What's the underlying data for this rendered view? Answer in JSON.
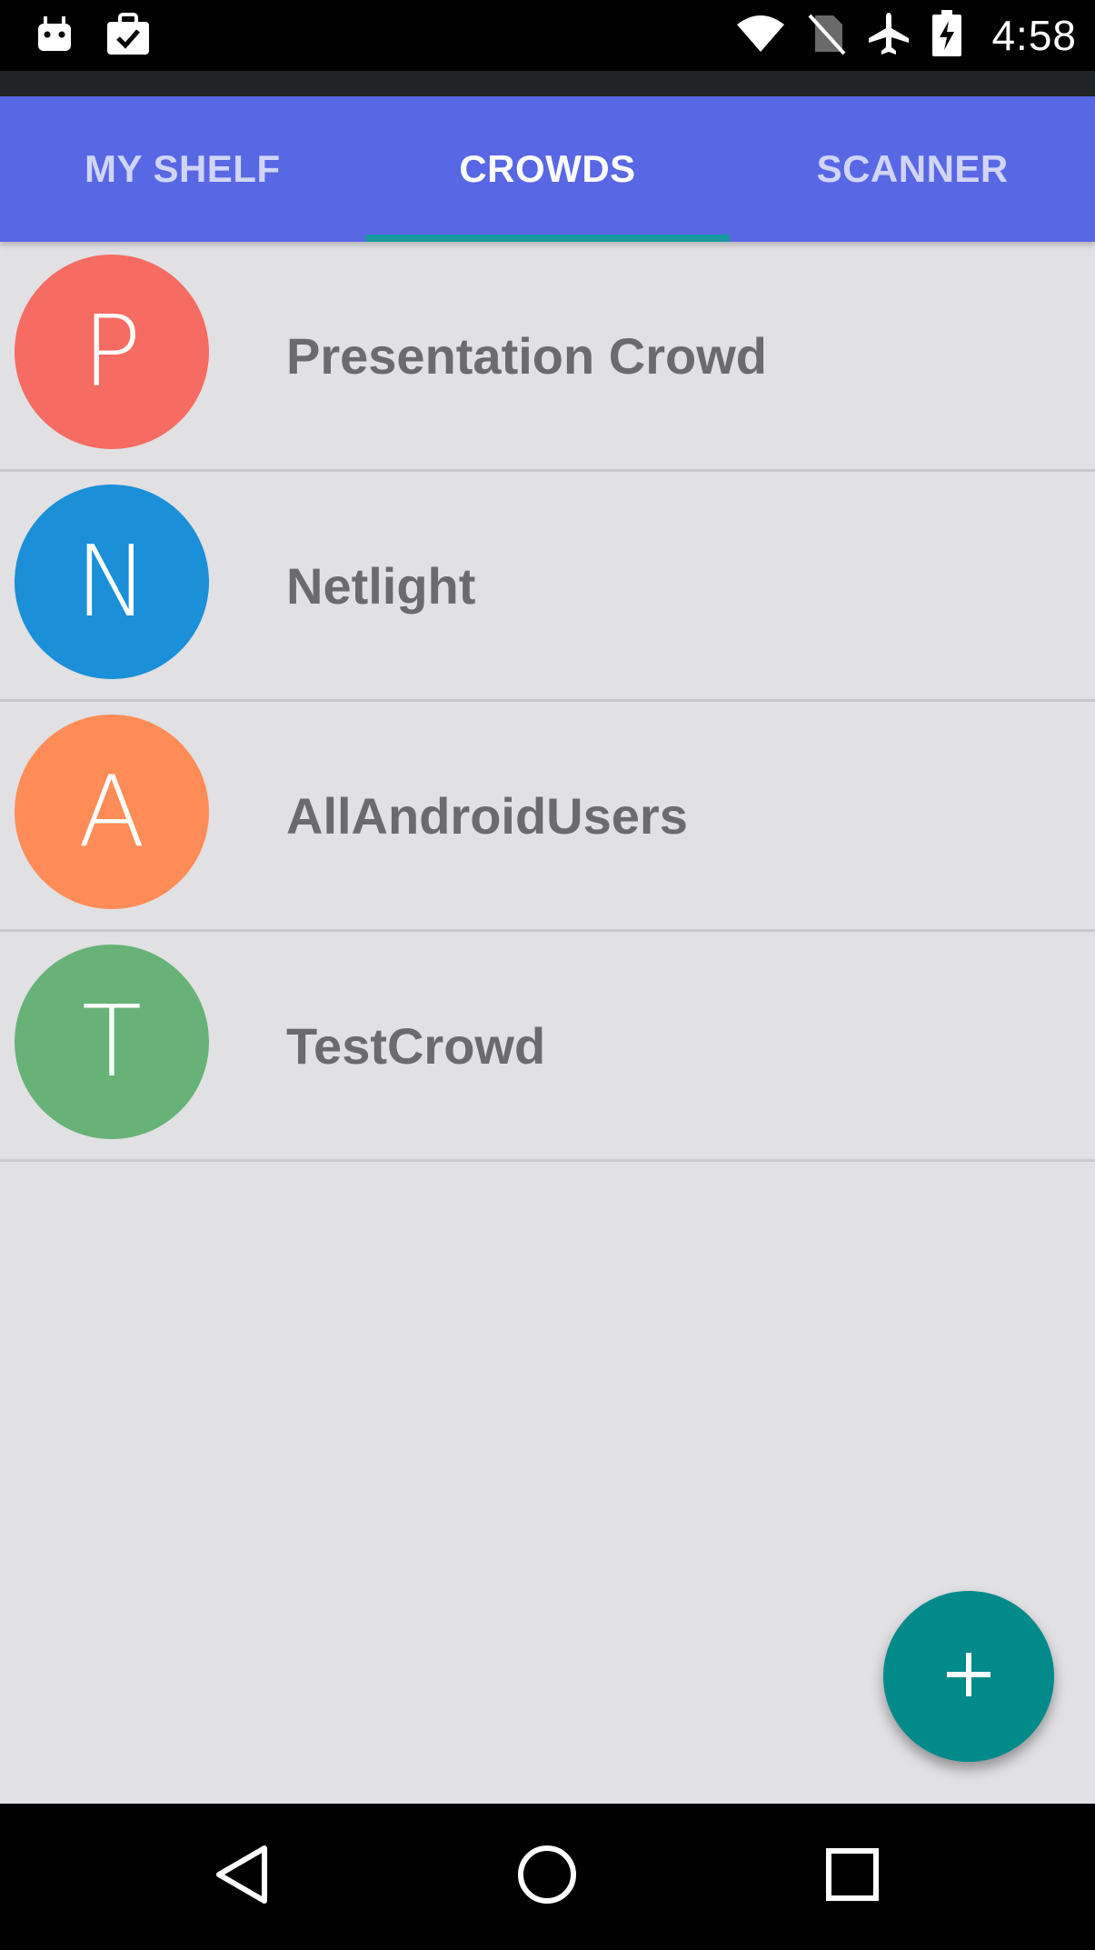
{
  "status_bar": {
    "time": "4:58",
    "left_icons": [
      "android-debug-icon",
      "clipboard-check-icon"
    ],
    "right_icons": [
      "wifi-icon",
      "no-sim-icon",
      "airplane-mode-icon",
      "battery-charging-icon"
    ]
  },
  "tabs": [
    {
      "label": "MY SHELF",
      "active": false
    },
    {
      "label": "CROWDS",
      "active": true
    },
    {
      "label": "SCANNER",
      "active": false
    }
  ],
  "crowds": [
    {
      "initial": "P",
      "name": "Presentation Crowd",
      "color": "#f66b62"
    },
    {
      "initial": "N",
      "name": "Netlight",
      "color": "#1b8fd8"
    },
    {
      "initial": "A",
      "name": "AllAndroidUsers",
      "color": "#ff8c57"
    },
    {
      "initial": "T",
      "name": "TestCrowd",
      "color": "#66b277"
    }
  ],
  "fab": {
    "icon": "plus-icon",
    "color": "#008a8a"
  },
  "colors": {
    "app_bar": "#5867e3",
    "tab_indicator": "#169a9e",
    "background": "#e1e0e3"
  },
  "nav_bar": {
    "icons": [
      "back-icon",
      "home-icon",
      "recents-icon"
    ]
  }
}
